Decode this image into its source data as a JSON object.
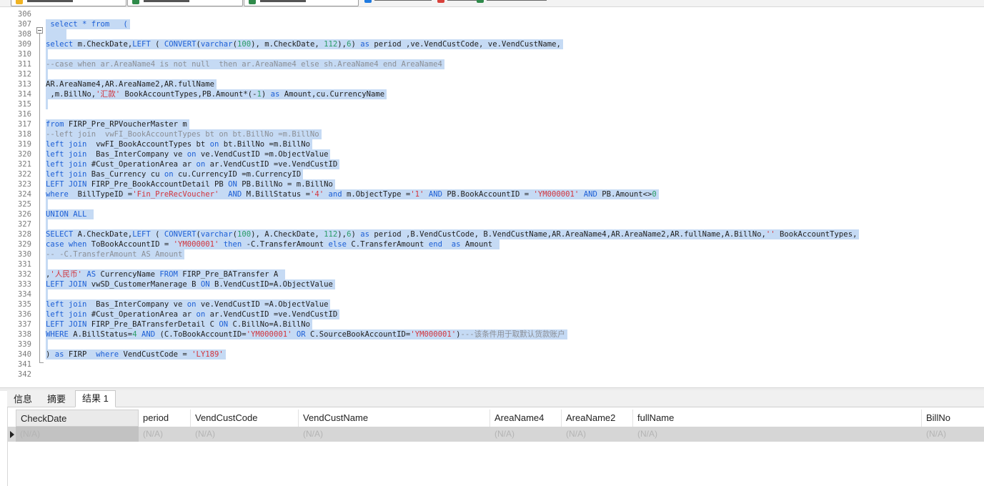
{
  "query_tabs": [
    {
      "icon": "query-icon",
      "color": "#f0b323"
    },
    {
      "icon": "query-icon",
      "color": "#2f8a4a"
    },
    {
      "icon": "query-icon",
      "color": "#2f8a4a"
    }
  ],
  "toolbar": {
    "buttons": [
      {
        "icon": "run-icon",
        "color": "#1f7ae0"
      },
      {
        "icon": "stop-icon",
        "color": "#d9413b"
      },
      {
        "icon": "explain-icon",
        "color": "#2f8a4a"
      }
    ]
  },
  "editor": {
    "lines": [
      {
        "n": "306",
        "t": []
      },
      {
        "n": "307",
        "t": [
          [
            " select * from   (",
            "kw"
          ]
        ]
      },
      {
        "n": "308",
        "t": [
          [
            "    ",
            ""
          ]
        ]
      },
      {
        "n": "309",
        "t": [
          [
            "select",
            "kw"
          ],
          [
            " m.CheckDate,",
            ""
          ],
          [
            "LEFT",
            "kw"
          ],
          [
            " ( ",
            ""
          ],
          [
            "CONVERT",
            "kw"
          ],
          [
            "(",
            ""
          ],
          [
            "varchar",
            "kw"
          ],
          [
            "(",
            ""
          ],
          [
            "100",
            "num"
          ],
          [
            "), m.CheckDate, ",
            ""
          ],
          [
            "112",
            "num"
          ],
          [
            "),",
            ""
          ],
          [
            "6",
            "num"
          ],
          [
            ") ",
            ""
          ],
          [
            "as",
            "kw"
          ],
          [
            " period ,ve.VendCustCode, ve.VendCustName,",
            ""
          ]
        ]
      },
      {
        "n": "310",
        "t": [
          [
            "",
            ""
          ]
        ]
      },
      {
        "n": "311",
        "t": [
          [
            "--case when ar.AreaName4 is not null  then ar.AreaName4 else sh.AreaName4 end AreaName4",
            "cm"
          ]
        ]
      },
      {
        "n": "312",
        "t": [
          [
            "",
            ""
          ]
        ]
      },
      {
        "n": "313",
        "t": [
          [
            "AR.AreaName4,AR.AreaName2,AR.fullName",
            ""
          ]
        ]
      },
      {
        "n": "314",
        "t": [
          [
            " ,m.BillNo,",
            ""
          ],
          [
            "'汇款'",
            "str"
          ],
          [
            " BookAccountTypes,PB.Amount*(-",
            ""
          ],
          [
            "1",
            "num"
          ],
          [
            ") ",
            ""
          ],
          [
            "as",
            "kw"
          ],
          [
            " Amount,cu.CurrencyName",
            ""
          ]
        ]
      },
      {
        "n": "315",
        "t": [
          [
            "",
            ""
          ]
        ]
      },
      {
        "n": "316",
        "t": []
      },
      {
        "n": "317",
        "t": [
          [
            "from",
            "kw"
          ],
          [
            " FIRP_Pre_RPVoucherMaster m",
            ""
          ]
        ]
      },
      {
        "n": "318",
        "t": [
          [
            "--left join  vwFI_BookAccountTypes bt on bt.BillNo =m.BillNo",
            "cm"
          ]
        ]
      },
      {
        "n": "319",
        "t": [
          [
            "left join",
            "kw"
          ],
          [
            "  vwFI_BookAccountTypes bt ",
            ""
          ],
          [
            "on",
            "kw"
          ],
          [
            " bt.BillNo =m.BillNo",
            ""
          ]
        ]
      },
      {
        "n": "320",
        "t": [
          [
            "left join",
            "kw"
          ],
          [
            "  Bas_InterCompany ve ",
            ""
          ],
          [
            "on",
            "kw"
          ],
          [
            " ve.VendCustID =m.ObjectValue",
            ""
          ]
        ]
      },
      {
        "n": "321",
        "t": [
          [
            "left join",
            "kw"
          ],
          [
            " #Cust_OperationArea ar ",
            ""
          ],
          [
            "on",
            "kw"
          ],
          [
            " ar.VendCustID =ve.VendCustID",
            ""
          ]
        ]
      },
      {
        "n": "322",
        "t": [
          [
            "left join",
            "kw"
          ],
          [
            " Bas_Currency cu ",
            ""
          ],
          [
            "on",
            "kw"
          ],
          [
            " cu.CurrencyID =m.CurrencyID",
            ""
          ]
        ]
      },
      {
        "n": "323",
        "t": [
          [
            "LEFT JOIN",
            "kw"
          ],
          [
            " FIRP_Pre_BookAccountDetail PB ",
            ""
          ],
          [
            "ON",
            "kw"
          ],
          [
            " PB.BillNo = m.BillNo",
            ""
          ]
        ]
      },
      {
        "n": "324",
        "t": [
          [
            "where",
            "kw"
          ],
          [
            "  BillTypeID =",
            ""
          ],
          [
            "'Fin_PreRecVoucher'",
            "str"
          ],
          [
            "  ",
            ""
          ],
          [
            "AND",
            "kw"
          ],
          [
            " M.BillStatus =",
            ""
          ],
          [
            "'4'",
            "str"
          ],
          [
            " ",
            ""
          ],
          [
            "and",
            "kw"
          ],
          [
            " m.ObjectType =",
            ""
          ],
          [
            "'1'",
            "str"
          ],
          [
            " ",
            ""
          ],
          [
            "AND",
            "kw"
          ],
          [
            " PB.BookAccountID = ",
            ""
          ],
          [
            "'YM000001'",
            "str"
          ],
          [
            " ",
            ""
          ],
          [
            "AND",
            "kw"
          ],
          [
            " PB.Amount<>",
            ""
          ],
          [
            "0",
            "num"
          ]
        ]
      },
      {
        "n": "325",
        "t": [
          [
            "",
            ""
          ]
        ]
      },
      {
        "n": "326",
        "t": [
          [
            "UNION ALL",
            "kw"
          ],
          [
            " ",
            ""
          ]
        ]
      },
      {
        "n": "327",
        "t": [
          [
            "",
            ""
          ]
        ]
      },
      {
        "n": "328",
        "t": [
          [
            "SELECT",
            "kw"
          ],
          [
            " A.CheckDate,",
            ""
          ],
          [
            "LEFT",
            "kw"
          ],
          [
            " ( ",
            ""
          ],
          [
            "CONVERT",
            "kw"
          ],
          [
            "(",
            ""
          ],
          [
            "varchar",
            "kw"
          ],
          [
            "(",
            ""
          ],
          [
            "100",
            "num"
          ],
          [
            "), A.CheckDate, ",
            ""
          ],
          [
            "112",
            "num"
          ],
          [
            "),",
            ""
          ],
          [
            "6",
            "num"
          ],
          [
            ") ",
            ""
          ],
          [
            "as",
            "kw"
          ],
          [
            " period ,B.VendCustCode, B.VendCustName,AR.AreaName4,AR.AreaName2,AR.fullName,A.BillNo,",
            ""
          ],
          [
            "''",
            "str"
          ],
          [
            " BookAccountTypes,",
            ""
          ]
        ]
      },
      {
        "n": "329",
        "t": [
          [
            "case",
            "kw"
          ],
          [
            " ",
            ""
          ],
          [
            "when",
            "kw"
          ],
          [
            " ToBookAccountID = ",
            ""
          ],
          [
            "'YM000001'",
            "str"
          ],
          [
            " ",
            ""
          ],
          [
            "then",
            "kw"
          ],
          [
            " -C.TransferAmount ",
            ""
          ],
          [
            "else",
            "kw"
          ],
          [
            " C.TransferAmount ",
            ""
          ],
          [
            "end",
            "kw"
          ],
          [
            "  ",
            ""
          ],
          [
            "as",
            "kw"
          ],
          [
            " Amount ",
            ""
          ]
        ]
      },
      {
        "n": "330",
        "t": [
          [
            "-- -C.TransferAmount AS Amount",
            "cm"
          ]
        ]
      },
      {
        "n": "331",
        "t": [
          [
            "",
            ""
          ]
        ]
      },
      {
        "n": "332",
        "t": [
          [
            ",",
            ""
          ],
          [
            "'人民币'",
            "str"
          ],
          [
            " ",
            ""
          ],
          [
            "AS",
            "kw"
          ],
          [
            " CurrencyName ",
            ""
          ],
          [
            "FROM",
            "kw"
          ],
          [
            " FIRP_Pre_BATransfer A ",
            ""
          ]
        ]
      },
      {
        "n": "333",
        "t": [
          [
            "LEFT JOIN",
            "kw"
          ],
          [
            " vwSD_CustomerManerage B ",
            ""
          ],
          [
            "ON",
            "kw"
          ],
          [
            " B.VendCustID=A.ObjectValue",
            ""
          ]
        ]
      },
      {
        "n": "334",
        "t": [
          [
            "",
            ""
          ]
        ]
      },
      {
        "n": "335",
        "t": [
          [
            "left join",
            "kw"
          ],
          [
            "  Bas_InterCompany ve ",
            ""
          ],
          [
            "on",
            "kw"
          ],
          [
            " ve.VendCustID =A.ObjectValue",
            ""
          ]
        ]
      },
      {
        "n": "336",
        "t": [
          [
            "left join",
            "kw"
          ],
          [
            " #Cust_OperationArea ar ",
            ""
          ],
          [
            "on",
            "kw"
          ],
          [
            " ar.VendCustID =ve.VendCustID",
            ""
          ]
        ]
      },
      {
        "n": "337",
        "t": [
          [
            "LEFT JOIN",
            "kw"
          ],
          [
            " FIRP_Pre_BATransferDetail C ",
            ""
          ],
          [
            "ON",
            "kw"
          ],
          [
            " C.BillNo=A.BillNo",
            ""
          ]
        ]
      },
      {
        "n": "338",
        "t": [
          [
            "WHERE",
            "kw"
          ],
          [
            " A.BillStatus=",
            ""
          ],
          [
            "4",
            "num"
          ],
          [
            " ",
            ""
          ],
          [
            "AND",
            "kw"
          ],
          [
            " (C.ToBookAccountID=",
            ""
          ],
          [
            "'YM000001'",
            "str"
          ],
          [
            " ",
            ""
          ],
          [
            "OR",
            "kw"
          ],
          [
            " C.SourceBookAccountID=",
            ""
          ],
          [
            "'YM000001'",
            "str"
          ],
          [
            ")",
            ""
          ],
          [
            "---该条件用于取默认货款账户",
            "cm"
          ]
        ]
      },
      {
        "n": "339",
        "t": [
          [
            "",
            ""
          ]
        ]
      },
      {
        "n": "340",
        "t": [
          [
            ") ",
            ""
          ],
          [
            "as",
            "kw"
          ],
          [
            " FIRP  ",
            ""
          ],
          [
            "where",
            "kw"
          ],
          [
            " VendCustCode = ",
            ""
          ],
          [
            "'LY189'",
            "str"
          ]
        ]
      },
      {
        "n": "341",
        "t": []
      },
      {
        "n": "342",
        "t": []
      }
    ]
  },
  "result_tabs": [
    {
      "label": "信息",
      "active": false
    },
    {
      "label": "摘要",
      "active": false
    },
    {
      "label": "结果 1",
      "active": true
    }
  ],
  "grid": {
    "columns": [
      "CheckDate",
      "period",
      "VendCustCode",
      "VendCustName",
      "AreaName4",
      "AreaName2",
      "fullName",
      "BillNo"
    ],
    "rows": [
      [
        "(N/A)",
        "(N/A)",
        "(N/A)",
        "(N/A)",
        "(N/A)",
        "(N/A)",
        "(N/A)",
        "(N/A)"
      ]
    ]
  }
}
